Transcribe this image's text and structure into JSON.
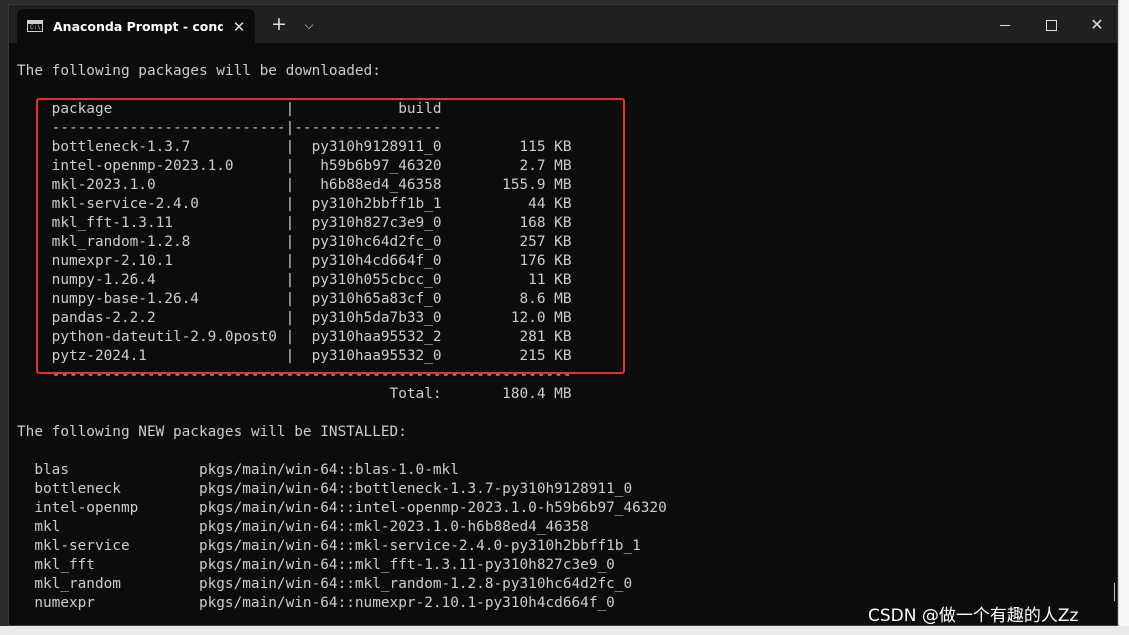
{
  "window": {
    "tab_title": "Anaconda Prompt - conda  ac",
    "tab_icon": "terminal-icon",
    "new_tab_symbol": "+",
    "dropdown_symbol": "⌵",
    "close_symbol": "✕"
  },
  "terminal": {
    "lines": [
      "",
      "The following packages will be downloaded:",
      "",
      "    package                    |            build",
      "    ---------------------------|-----------------",
      "    bottleneck-1.3.7           |  py310h9128911_0         115 KB",
      "    intel-openmp-2023.1.0      |   h59b6b97_46320         2.7 MB",
      "    mkl-2023.1.0               |   h6b88ed4_46358       155.9 MB",
      "    mkl-service-2.4.0          |  py310h2bbff1b_1          44 KB",
      "    mkl_fft-1.3.11             |  py310h827c3e9_0         168 KB",
      "    mkl_random-1.2.8           |  py310hc64d2fc_0         257 KB",
      "    numexpr-2.10.1             |  py310h4cd664f_0         176 KB",
      "    numpy-1.26.4               |  py310h055cbcc_0          11 KB",
      "    numpy-base-1.26.4          |  py310h65a83cf_0         8.6 MB",
      "    pandas-2.2.2               |  py310h5da7b33_0        12.0 MB",
      "    python-dateutil-2.9.0post0 |  py310haa95532_2         281 KB",
      "    pytz-2024.1                |  py310haa95532_0         215 KB",
      "    ------------------------------------------------------------",
      "                                           Total:       180.4 MB",
      "",
      "The following NEW packages will be INSTALLED:",
      "",
      "  blas               pkgs/main/win-64::blas-1.0-mkl",
      "  bottleneck         pkgs/main/win-64::bottleneck-1.3.7-py310h9128911_0",
      "  intel-openmp       pkgs/main/win-64::intel-openmp-2023.1.0-h59b6b97_46320",
      "  mkl                pkgs/main/win-64::mkl-2023.1.0-h6b88ed4_46358",
      "  mkl-service        pkgs/main/win-64::mkl-service-2.4.0-py310h2bbff1b_1",
      "  mkl_fft            pkgs/main/win-64::mkl_fft-1.3.11-py310h827c3e9_0",
      "  mkl_random         pkgs/main/win-64::mkl_random-1.2.8-py310hc64d2fc_0",
      "  numexpr            pkgs/main/win-64::numexpr-2.10.1-py310h4cd664f_0"
    ]
  },
  "watermark": "CSDN @做一个有趣的人Zz",
  "colors": {
    "terminal_bg": "#0c0c0c",
    "terminal_text": "#cccccc",
    "highlight_border": "#e5312b"
  }
}
